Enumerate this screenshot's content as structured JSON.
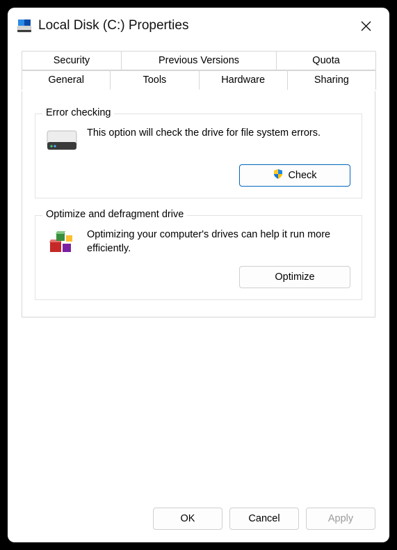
{
  "window": {
    "title": "Local Disk (C:) Properties"
  },
  "tabs": {
    "row1": [
      "Security",
      "Previous Versions",
      "Quota"
    ],
    "row2": [
      "General",
      "Tools",
      "Hardware",
      "Sharing"
    ],
    "active": "Tools"
  },
  "error_checking": {
    "title": "Error checking",
    "description": "This option will check the drive for file system errors.",
    "button": "Check"
  },
  "optimize": {
    "title": "Optimize and defragment drive",
    "description": "Optimizing your computer's drives can help it run more efficiently.",
    "button": "Optimize"
  },
  "footer": {
    "ok": "OK",
    "cancel": "Cancel",
    "apply": "Apply"
  }
}
